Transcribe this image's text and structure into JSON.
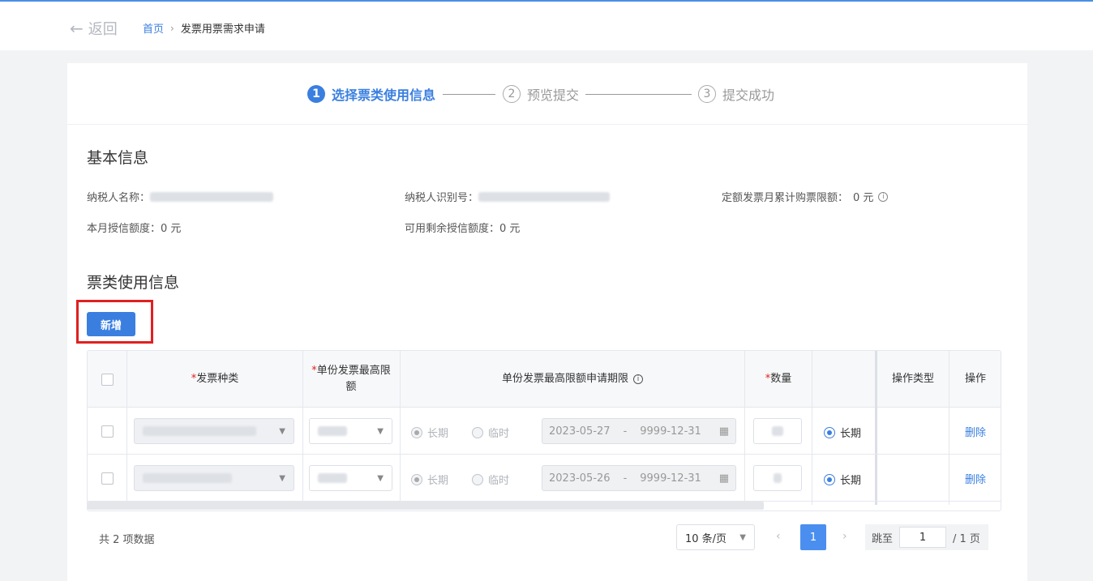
{
  "header": {
    "back_label": "返回",
    "breadcrumb": {
      "home": "首页",
      "current": "发票用票需求申请"
    }
  },
  "steps": [
    {
      "num": "1",
      "label": "选择票类使用信息",
      "state": "active"
    },
    {
      "num": "2",
      "label": "预览提交",
      "state": "idle"
    },
    {
      "num": "3",
      "label": "提交成功",
      "state": "idle"
    }
  ],
  "basic_info": {
    "title": "基本信息",
    "taxpayer_name_label": "纳税人名称：",
    "taxpayer_id_label": "纳税人识别号：",
    "quota_label": "定额发票月累计购票限额：",
    "quota_value": "0 元",
    "monthly_credit_label": "本月授信额度：",
    "monthly_credit_value": "0 元",
    "remaining_credit_label": "可用剩余授信额度：",
    "remaining_credit_value": "0 元"
  },
  "usage": {
    "title": "票类使用信息",
    "add_button": "新增"
  },
  "table": {
    "headers": {
      "invoice_type": "发票种类",
      "max_amount": "单份发票最高限额",
      "period": "单份发票最高限额申请期限",
      "quantity": "数量",
      "op_type": "操作类型",
      "op": "操作"
    },
    "rows": [
      {
        "period_long": "长期",
        "period_temp": "临时",
        "start": "2023-05-27",
        "sep": "-",
        "end": "9999-12-31",
        "term": "长期",
        "action": "删除"
      },
      {
        "period_long": "长期",
        "period_temp": "临时",
        "start": "2023-05-26",
        "sep": "-",
        "end": "9999-12-31",
        "term": "长期",
        "action": "删除"
      }
    ]
  },
  "pagination": {
    "total": "共 2 项数据",
    "page_size": "10 条/页",
    "current": "1",
    "jump_label": "跳至",
    "jump_value": "1",
    "of_pages": "/ 1 页"
  },
  "colors": {
    "primary": "#3a7fe0",
    "highlight_box": "#e02020"
  }
}
